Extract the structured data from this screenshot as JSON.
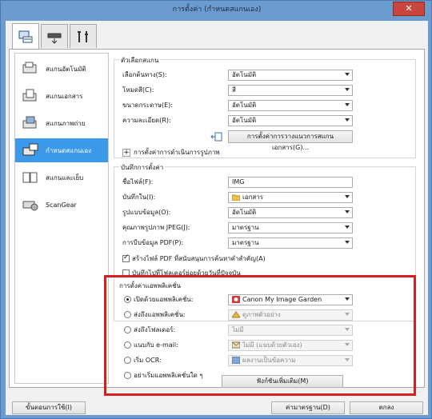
{
  "window": {
    "title": "การตั้งค่า (กำหนดสแกนเอง)",
    "close": "✕"
  },
  "tabs": [
    {
      "name": "scan-tab",
      "icon": "scanner-computer-icon"
    },
    {
      "name": "scanner-tab",
      "icon": "scanner-icon"
    },
    {
      "name": "general-tab",
      "icon": "tools-icon"
    }
  ],
  "nav": [
    {
      "label": "สแกนอัตโนมัติ",
      "icon": "auto-scan-icon",
      "selected": false
    },
    {
      "label": "สแกนเอกสาร",
      "icon": "document-scan-icon",
      "selected": false
    },
    {
      "label": "สแกนภาพถ่าย",
      "icon": "photo-scan-icon",
      "selected": false
    },
    {
      "label": "กำหนดสแกนเอง",
      "icon": "custom-scan-icon",
      "selected": true
    },
    {
      "label": "สแกนและเย็บ",
      "icon": "scan-stitch-icon",
      "selected": false
    },
    {
      "label": "ScanGear",
      "icon": "scangear-icon",
      "selected": false
    }
  ],
  "scan_options": {
    "title": "ตัวเลือกสแกน",
    "rows": [
      {
        "label": "เลือกต้นทาง(S):",
        "value": "อัตโนมัติ"
      },
      {
        "label": "โหมดสี(C):",
        "value": "สี"
      },
      {
        "label": "ขนาดกระดาษ(E):",
        "value": "อัตโนมัติ"
      },
      {
        "label": "ความละเอียด(R):",
        "value": "อัตโนมัติ"
      }
    ],
    "doc_settings_button": "การตั้งค่าการวางแนวการสแกนเอกสาร(G)...",
    "image_processing": "การตั้งค่าการดำเนินการรูปภาพ"
  },
  "save_settings": {
    "title": "บันทึกการตั้งค่า",
    "rows": [
      {
        "label": "ชื่อไฟล์(F):",
        "value": "IMG",
        "type": "input"
      },
      {
        "label": "บันทึกใน(I):",
        "value": "เอกสาร",
        "type": "select",
        "icon": "folder-icon"
      },
      {
        "label": "รูปแบบข้อมูล(O):",
        "value": "อัตโนมัติ",
        "type": "select"
      },
      {
        "label": "คุณภาพรูปภาพ JPEG(J):",
        "value": "มาตรฐาน",
        "type": "select"
      },
      {
        "label": "การบีบข้อมูล PDF(P):",
        "value": "มาตรฐาน",
        "type": "select"
      }
    ],
    "checkbox1": "สร้างไฟล์ PDF ที่สนับสนุนการค้นหาคำสำคัญ(A)",
    "checkbox2": "บันทึกไปที่โฟลเดอร์ย่อยด้วยวันที่ปัจจุบัน"
  },
  "app_settings": {
    "title": "การตั้งค่าแอพพลิเคชั่น",
    "rows": [
      {
        "label": "เปิดด้วยแอพพลิเคชั่น:",
        "value": "Canon My Image Garden",
        "checked": true,
        "disabled": false,
        "icon": "image-garden-icon"
      },
      {
        "label": "ส่งถึงแอพพลิเคชั่น:",
        "value": "ดูภาพตัวอย่าง",
        "checked": false,
        "disabled": true,
        "icon": "preview-icon"
      },
      {
        "label": "ส่งถึงโฟลเดอร์:",
        "value": "ไม่มี",
        "checked": false,
        "disabled": true,
        "icon": ""
      },
      {
        "label": "แนบกับ e-mail:",
        "value": "ไม่มี (แนบด้วยตัวเอง)",
        "checked": false,
        "disabled": true,
        "icon": "mail-icon"
      },
      {
        "label": "เริ่ม OCR:",
        "value": "ผลงานเป็นข้อความ",
        "checked": false,
        "disabled": true,
        "icon": "ocr-icon"
      },
      {
        "label": "อย่าเริ่มแอพพลิเคชั่นใด ๆ",
        "value": "",
        "checked": false,
        "disabled": false,
        "icon": ""
      }
    ],
    "more_functions_button": "ฟังก์ชันเพิ่มเติม(M)"
  },
  "footer": {
    "instructions": "ขั้นตอนการใช้(I)",
    "defaults": "ค่ามาตรฐาน(D)",
    "ok": "ตกลง"
  },
  "colors": {
    "highlight": "#d7201d",
    "selected_nav": "#3c98e8",
    "title_bar": "#6b9bcf"
  }
}
